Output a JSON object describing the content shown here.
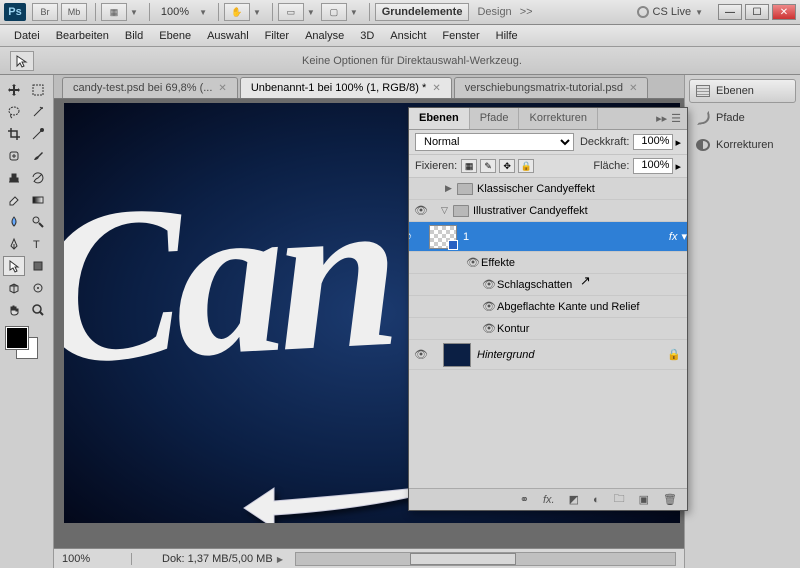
{
  "appbar": {
    "logo": "Ps",
    "br": "Br",
    "mb": "Mb",
    "zoom": "100%",
    "workspace_active": "Grundelemente",
    "workspace_other": "Design",
    "more": ">>",
    "cslive": "CS Live"
  },
  "menu": [
    "Datei",
    "Bearbeiten",
    "Bild",
    "Ebene",
    "Auswahl",
    "Filter",
    "Analyse",
    "3D",
    "Ansicht",
    "Fenster",
    "Hilfe"
  ],
  "options": {
    "message": "Keine Optionen für Direktauswahl-Werkzeug."
  },
  "tabs": [
    {
      "label": "candy-test.psd bei 69,8% (...",
      "active": false
    },
    {
      "label": "Unbenannt-1 bei 100% (1, RGB/8) *",
      "active": true
    },
    {
      "label": "verschiebungsmatrix-tutorial.psd",
      "active": false
    }
  ],
  "canvas": {
    "text": "Can"
  },
  "status": {
    "zoom": "100%",
    "doc": "Dok: 1,37 MB/5,00 MB"
  },
  "layersPanel": {
    "tabs": [
      "Ebenen",
      "Pfade",
      "Korrekturen"
    ],
    "blend": "Normal",
    "opacityLabel": "Deckkraft:",
    "opacity": "100%",
    "lockLabel": "Fixieren:",
    "fillLabel": "Fläche:",
    "fill": "100%",
    "items": {
      "group1": "Klassischer Candyeffekt",
      "group2": "Illustrativer Candyeffekt",
      "layer1": "1",
      "fx1": "fx",
      "effects": "Effekte",
      "e1": "Schlagschatten",
      "e2": "Abgeflachte Kante und Relief",
      "e3": "Kontur",
      "bg": "Hintergrund"
    }
  },
  "dock": {
    "ebenen": "Ebenen",
    "pfade": "Pfade",
    "korrekturen": "Korrekturen"
  }
}
